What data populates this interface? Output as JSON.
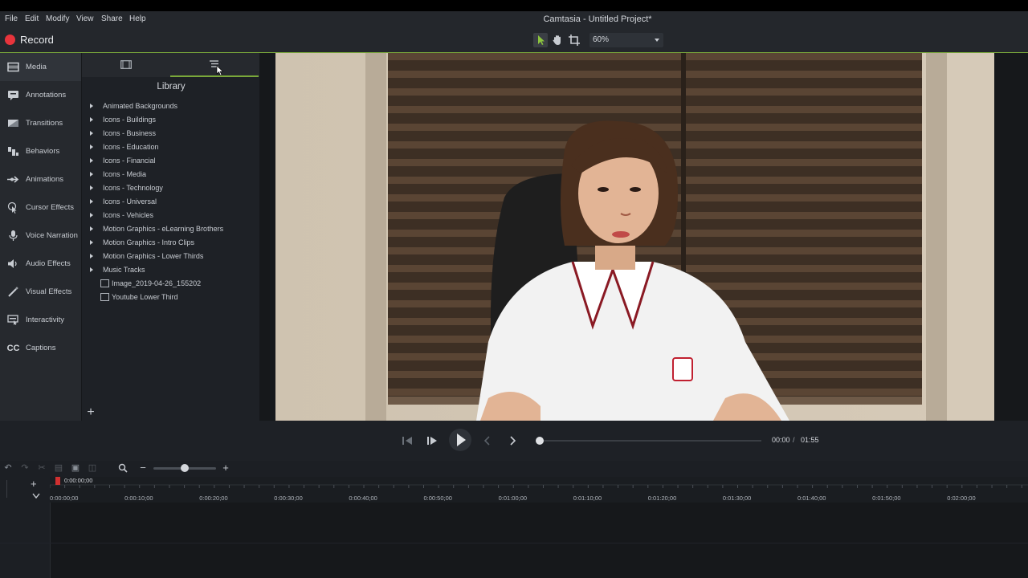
{
  "window": {
    "title": "Camtasia - Untitled Project*"
  },
  "menu": [
    "File",
    "Edit",
    "Modify",
    "View",
    "Share",
    "Help"
  ],
  "toolbar": {
    "record_label": "Record",
    "zoom_value": "60%",
    "accent": "#7aa83a",
    "record_color": "#e8343c"
  },
  "sidebar": {
    "items": [
      {
        "label": "Media",
        "icon": "film-icon"
      },
      {
        "label": "Annotations",
        "icon": "callout-icon"
      },
      {
        "label": "Transitions",
        "icon": "transition-icon"
      },
      {
        "label": "Behaviors",
        "icon": "behaviors-icon"
      },
      {
        "label": "Animations",
        "icon": "animation-arrow-icon"
      },
      {
        "label": "Cursor Effects",
        "icon": "cursor-icon"
      },
      {
        "label": "Voice Narration",
        "icon": "microphone-icon"
      },
      {
        "label": "Audio Effects",
        "icon": "speaker-icon"
      },
      {
        "label": "Visual Effects",
        "icon": "magic-wand-icon"
      },
      {
        "label": "Interactivity",
        "icon": "interactivity-icon"
      },
      {
        "label": "Captions",
        "icon": "cc-icon"
      }
    ]
  },
  "library": {
    "title": "Library",
    "folders": [
      "Animated Backgrounds",
      "Icons - Buildings",
      "Icons - Business",
      "Icons - Education",
      "Icons - Financial",
      "Icons - Media",
      "Icons - Technology",
      "Icons - Universal",
      "Icons - Vehicles",
      "Motion Graphics - eLearning Brothers",
      "Motion Graphics - Intro Clips",
      "Motion Graphics - Lower Thirds",
      "Music Tracks"
    ],
    "files": [
      "Image_2019-04-26_155202",
      "Youtube Lower Third"
    ]
  },
  "playback": {
    "current": "00:00",
    "separator": "/",
    "total": "01:55",
    "progress": 0
  },
  "timeline": {
    "playhead_label": "0:00:00;00",
    "ticks": [
      "0:00:00;00",
      "0:00:10;00",
      "0:00:20;00",
      "0:00:30;00",
      "0:00:40;00",
      "0:00:50;00",
      "0:01:00;00",
      "0:01:10;00",
      "0:01:20;00",
      "0:01:30;00",
      "0:01:40;00",
      "0:01:50;00",
      "0:02:00;00"
    ]
  }
}
